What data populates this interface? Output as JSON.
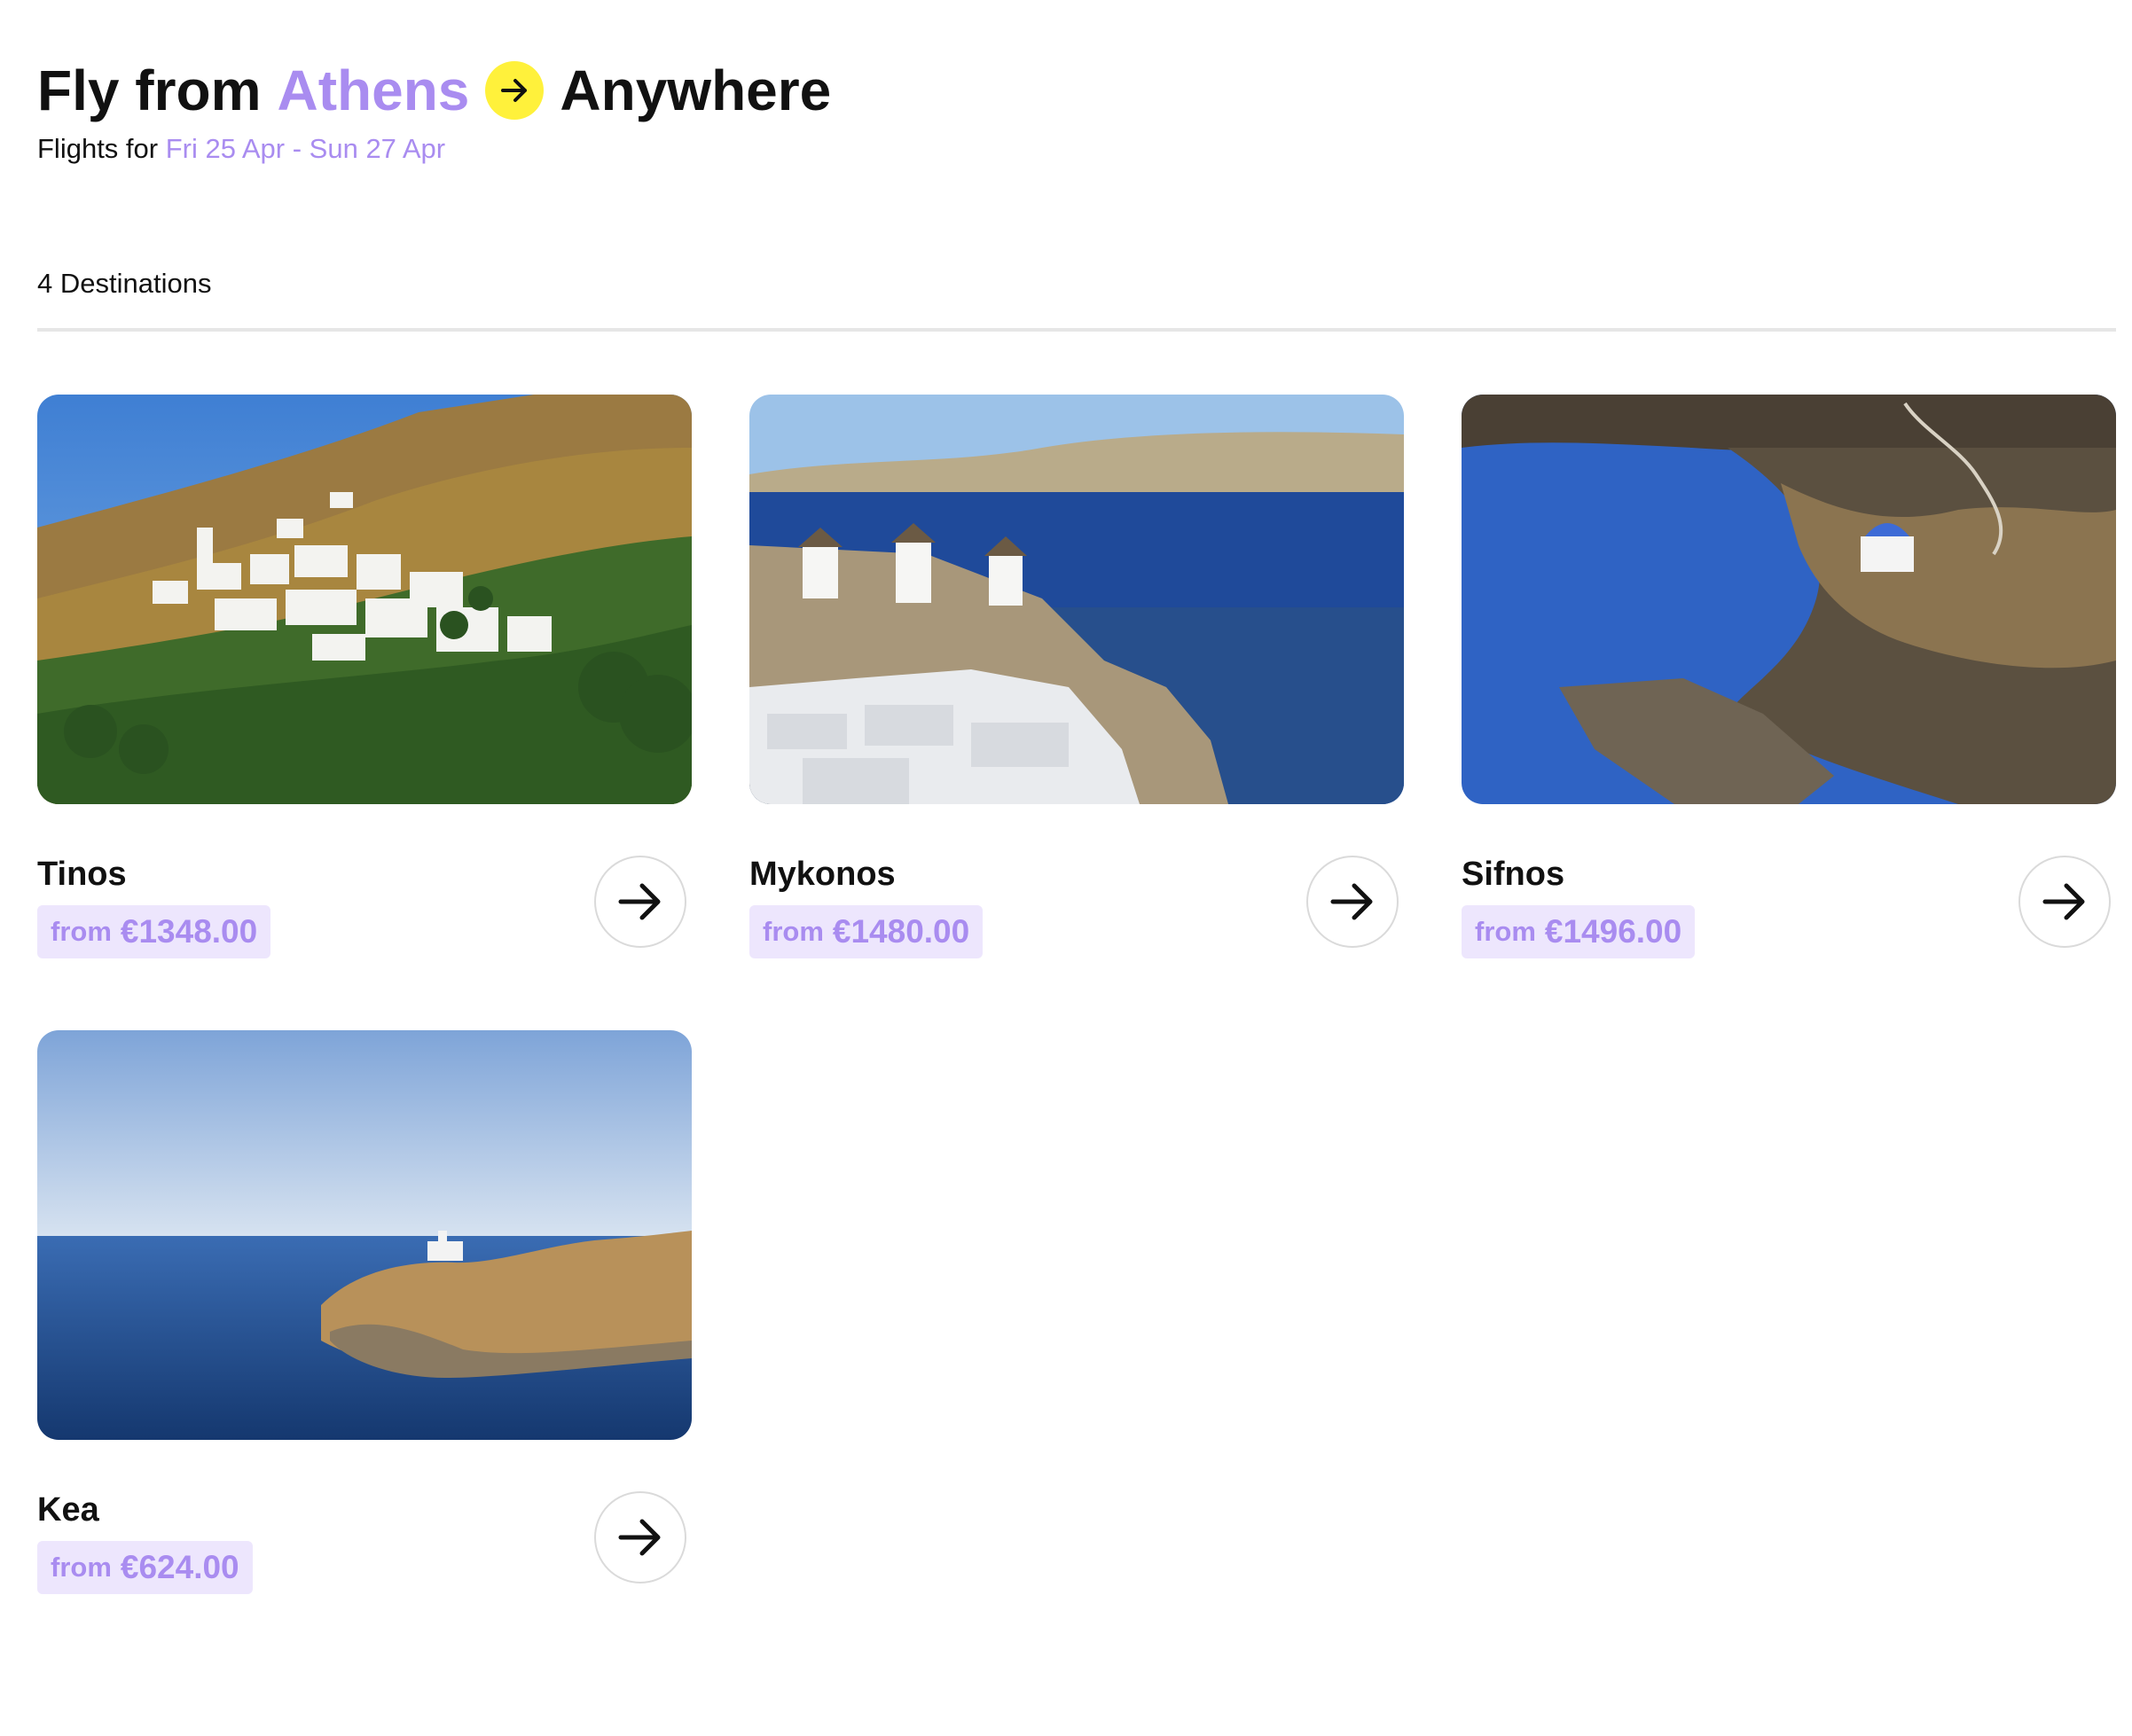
{
  "header": {
    "title_prefix": "Fly from",
    "origin": "Athens",
    "arrow_icon": "arrow-right-icon",
    "destination": "Anywhere",
    "subtitle_prefix": "Flights for",
    "dates": "Fri 25 Apr - Sun 27 Apr"
  },
  "results": {
    "count_label": "4 Destinations"
  },
  "destinations": [
    {
      "name": "Tinos",
      "from_label": "from",
      "price": "€1348.00",
      "photo": "tinos-village-photo"
    },
    {
      "name": "Mykonos",
      "from_label": "from",
      "price": "€1480.00",
      "photo": "mykonos-windmills-photo"
    },
    {
      "name": "Sifnos",
      "from_label": "from",
      "price": "€1496.00",
      "photo": "sifnos-chapel-coast-photo"
    },
    {
      "name": "Kea",
      "from_label": "from",
      "price": "€624.00",
      "photo": "kea-lighthouse-photo"
    }
  ],
  "colors": {
    "accent": "#a98cf0",
    "badge_bg": "#ede6fd",
    "arrow_badge": "#fff13b"
  }
}
